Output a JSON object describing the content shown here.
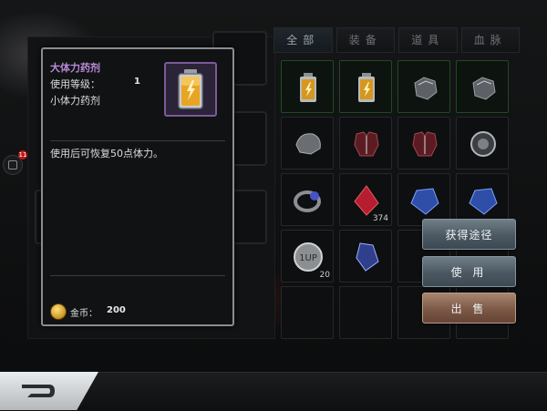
{
  "tabs": [
    {
      "label": "全部",
      "active": true
    },
    {
      "label": "装备",
      "active": false
    },
    {
      "label": "道具",
      "active": false
    },
    {
      "label": "血脉",
      "active": false
    }
  ],
  "side_badge": {
    "count": "11"
  },
  "tooltip": {
    "name": "大体力药剂",
    "level_label": "使用等级：",
    "level_value": "1",
    "type": "小体力药剂",
    "description": "使用后可恢复50点体力。",
    "coin_label": "金币：",
    "coin_value": "200",
    "icon": "stamina-potion-icon"
  },
  "inventory": {
    "rows": [
      [
        {
          "icon": "stamina-potion-icon",
          "qty": "",
          "highlight": "green"
        },
        {
          "icon": "stamina-potion-icon",
          "qty": "",
          "highlight": "green"
        },
        {
          "icon": "gauntlet-icon",
          "qty": "",
          "highlight": "green"
        },
        {
          "icon": "gauntlet-icon",
          "qty": "",
          "highlight": "green"
        }
      ],
      [
        {
          "icon": "shoulder-armor-icon",
          "qty": "",
          "highlight": "none"
        },
        {
          "icon": "chest-armor-icon",
          "qty": "",
          "highlight": "none"
        },
        {
          "icon": "chest-armor-icon",
          "qty": "",
          "highlight": "none"
        },
        {
          "icon": "round-amulet-icon",
          "qty": "",
          "highlight": "none"
        }
      ],
      [
        {
          "icon": "ring-icon",
          "qty": "",
          "highlight": "none"
        },
        {
          "icon": "red-crystal-icon",
          "qty": "374",
          "highlight": "none"
        },
        {
          "icon": "blue-crystal-icon",
          "qty": "",
          "highlight": "none"
        },
        {
          "icon": "blue-crystal-icon",
          "qty": "",
          "highlight": "none"
        }
      ],
      [
        {
          "icon": "level-up-coin-icon",
          "qty": "20",
          "highlight": "none"
        },
        {
          "icon": "blue-gem-icon",
          "qty": "",
          "highlight": "none"
        },
        {
          "icon": "empty",
          "qty": "",
          "highlight": "none"
        },
        {
          "icon": "empty",
          "qty": "",
          "highlight": "none"
        }
      ],
      [
        {
          "icon": "empty",
          "qty": "",
          "highlight": "none"
        },
        {
          "icon": "empty",
          "qty": "",
          "highlight": "none"
        },
        {
          "icon": "empty",
          "qty": "",
          "highlight": "none"
        },
        {
          "icon": "empty",
          "qty": "",
          "highlight": "none"
        }
      ]
    ]
  },
  "actions": {
    "get_source": "获得途径",
    "use": "使 用",
    "sell": "出 售"
  },
  "colors": {
    "item_name": "#b78ad8",
    "sell_button": "#7c5846",
    "action_button": "#4b5862",
    "equipped_border": "#1f4a23"
  }
}
